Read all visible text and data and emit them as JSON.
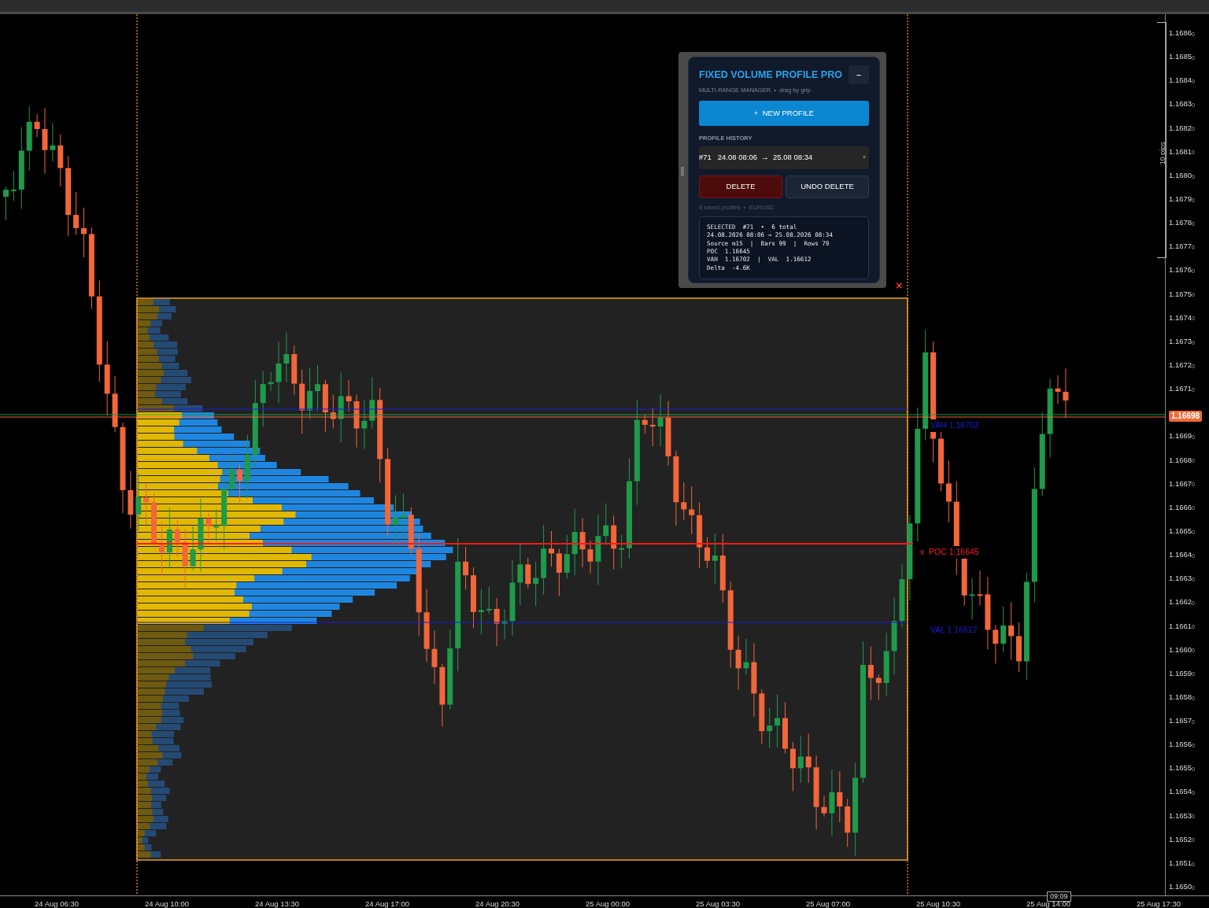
{
  "panel": {
    "title": "FIXED VOLUME PROFILE PRO",
    "minimize": "–",
    "subtitle": "MULTI-RANGE MANAGER  •  drag by grip",
    "new_button": "+  NEW PROFILE",
    "history_label": "PROFILE HISTORY",
    "history_select": {
      "value": "#71   24.08 08:06  →  25.08 08:34",
      "caret": "▾"
    },
    "delete_button": "DELETE",
    "undo_button": "UNDO DELETE",
    "footer": "6 saved profiles  •  EURUSD",
    "details": [
      "SELECTED  #71  •  6 total",
      "24.08.2026 08:06 → 25.08.2026 08:34",
      "Source m15  |  Bars 99  |  Rows 79",
      "POC  1.16645",
      "VAH  1.16702  |  VAL  1.16612",
      "Delta  -4.6K"
    ]
  },
  "chart": {
    "close_mark": "×",
    "ruler": "10 pips",
    "levels": [
      {
        "kind": "vah",
        "label": "VAH 1.16702"
      },
      {
        "kind": "poc",
        "marker": "x",
        "label": "POC 1.16645"
      },
      {
        "kind": "val",
        "label": "VAL 1.16612"
      }
    ]
  },
  "price_axis": {
    "ticks_upper": [
      "1.1686$_{0}$",
      "1.1685$_{0}$",
      "1.1684$_{0}$",
      "1.1683$_{0}$",
      "1.1682$_{0}$",
      "1.1681$_{0}$",
      "1.1680$_{0}$",
      "1.1679$_{0}$",
      "1.1678$_{0}$",
      "1.1677$_{0}$",
      "1.1676$_{0}$",
      "1.1675$_{0}$",
      "1.1674$_{0}$",
      "1.1673$_{0}$",
      "1.1672$_{0}$",
      "1.1671$_{0}$"
    ],
    "ticks_lower": [
      "1.1669$_{0}$",
      "1.1668$_{0}$",
      "1.1667$_{0}$",
      "1.1666$_{0}$",
      "1.1665$_{0}$",
      "1.1664$_{0}$",
      "1.1663$_{0}$",
      "1.1662$_{0}$",
      "1.1661$_{0}$",
      "1.1660$_{0}$",
      "1.1659$_{0}$",
      "1.1658$_{0}$",
      "1.1657$_{0}$",
      "1.1656$_{0}$",
      "1.1655$_{0}$",
      "1.1654$_{0}$",
      "1.1653$_{0}$",
      "1.1652$_{0}$",
      "1.1651$_{0}$",
      "1.1650$_{0}$"
    ],
    "current_price": "1.16698"
  },
  "time_axis": {
    "labels": [
      "24 Aug 06:30",
      "24 Aug 10:00",
      "24 Aug 13:30",
      "24 Aug 17:00",
      "24 Aug 20:30",
      "25 Aug 00:00",
      "25 Aug 03:30",
      "25 Aug 07:00",
      "25 Aug 10:30",
      "25 Aug 14:00",
      "25 Aug 17:30"
    ],
    "cursor_time": "09:09"
  }
}
